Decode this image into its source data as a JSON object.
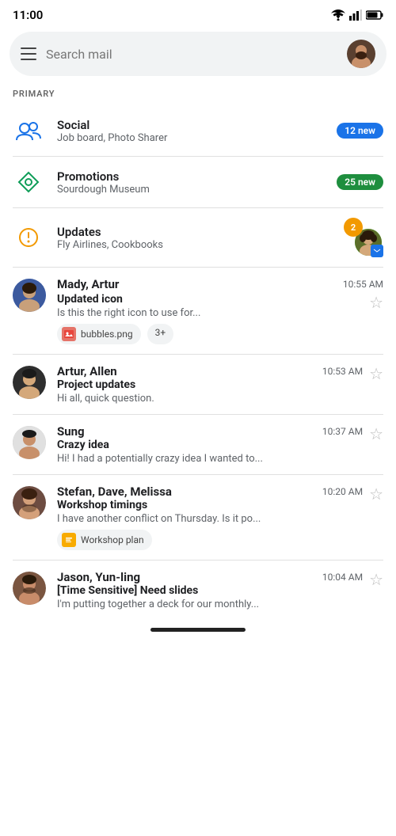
{
  "statusBar": {
    "time": "11:00"
  },
  "searchBar": {
    "placeholder": "Search mail"
  },
  "section": {
    "label": "PRIMARY"
  },
  "categories": [
    {
      "id": "social",
      "name": "Social",
      "sub": "Job board, Photo Sharer",
      "badgeText": "12 new",
      "badgeColor": "blue"
    },
    {
      "id": "promotions",
      "name": "Promotions",
      "sub": "Sourdough Museum",
      "badgeText": "25 new",
      "badgeColor": "green"
    },
    {
      "id": "updates",
      "name": "Updates",
      "sub": "Fly Airlines, Cookbooks",
      "badgeText": "2"
    }
  ],
  "emails": [
    {
      "id": "email-1",
      "sender": "Mady, Artur",
      "time": "10:55 AM",
      "subject": "Updated icon",
      "preview": "Is this the right icon to use for...",
      "attachments": [
        "bubbles.png"
      ],
      "moreAttachments": "3+",
      "avatarColor": "blue"
    },
    {
      "id": "email-2",
      "sender": "Artur, Allen",
      "time": "10:53 AM",
      "subject": "Project updates",
      "preview": "Hi all, quick question.",
      "attachments": [],
      "avatarColor": "dark"
    },
    {
      "id": "email-3",
      "sender": "Sung",
      "time": "10:37 AM",
      "subject": "Crazy idea",
      "preview": "Hi! I had a potentially crazy idea I wanted to...",
      "attachments": [],
      "avatarColor": "light"
    },
    {
      "id": "email-4",
      "sender": "Stefan, Dave, Melissa",
      "time": "10:20 AM",
      "subject": "Workshop timings",
      "preview": "I have another conflict on Thursday. Is it po...",
      "attachments": [
        "Workshop plan"
      ],
      "attachmentType": "doc",
      "avatarColor": "brown"
    },
    {
      "id": "email-5",
      "sender": "Jason, Yun-ling",
      "time": "10:04 AM",
      "subject": "[Time Sensitive] Need slides",
      "preview": "I'm putting together a deck for our monthly...",
      "attachments": [],
      "avatarColor": "beard"
    }
  ]
}
